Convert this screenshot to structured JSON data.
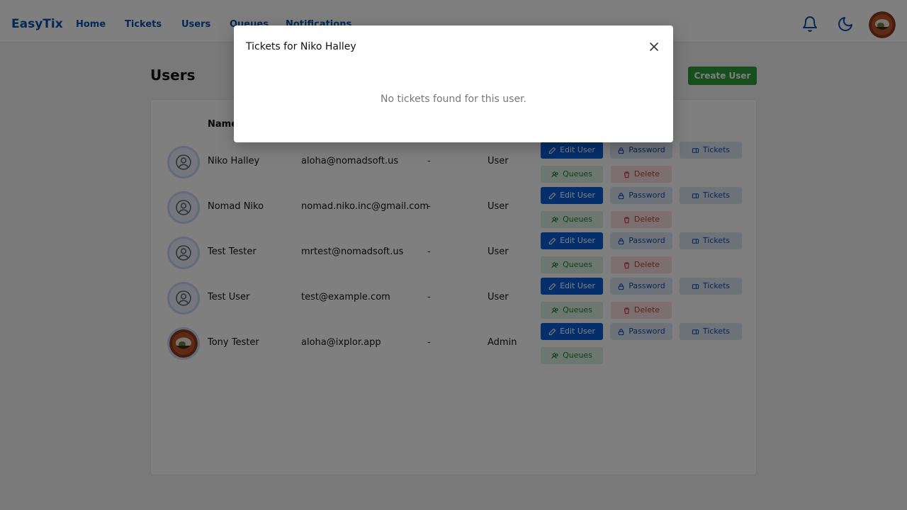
{
  "nav": {
    "brand": "EasyTix",
    "links": [
      "Home",
      "Tickets",
      "Users",
      "Queues",
      "Notifications"
    ]
  },
  "page": {
    "title": "Users",
    "create_label": "Create User",
    "column_name": "Name"
  },
  "actions": {
    "edit": "Edit User",
    "password": "Password",
    "tickets": "Tickets",
    "queues": "Queues",
    "delete": "Delete"
  },
  "users": [
    {
      "name": "Niko Halley",
      "email": "aloha@nomadsoft.us",
      "extra": "-",
      "role": "User"
    },
    {
      "name": "Nomad Niko",
      "email": "nomad.niko.inc@gmail.com",
      "extra": "-",
      "role": "User"
    },
    {
      "name": "Test Tester",
      "email": "mrtest@nomadsoft.us",
      "extra": "-",
      "role": "User"
    },
    {
      "name": "Test User",
      "email": "test@example.com",
      "extra": "-",
      "role": "User"
    },
    {
      "name": "Tony Tester",
      "email": "aloha@ixplor.app",
      "extra": "-",
      "role": "Admin"
    }
  ],
  "modal": {
    "title": "Tickets for Niko Halley",
    "empty_message": "No tickets found for this user."
  },
  "colors": {
    "brand": "#0a4fae",
    "primary": "#0a5fd6",
    "success": "#2e9c3c",
    "danger": "#c23a3a"
  }
}
